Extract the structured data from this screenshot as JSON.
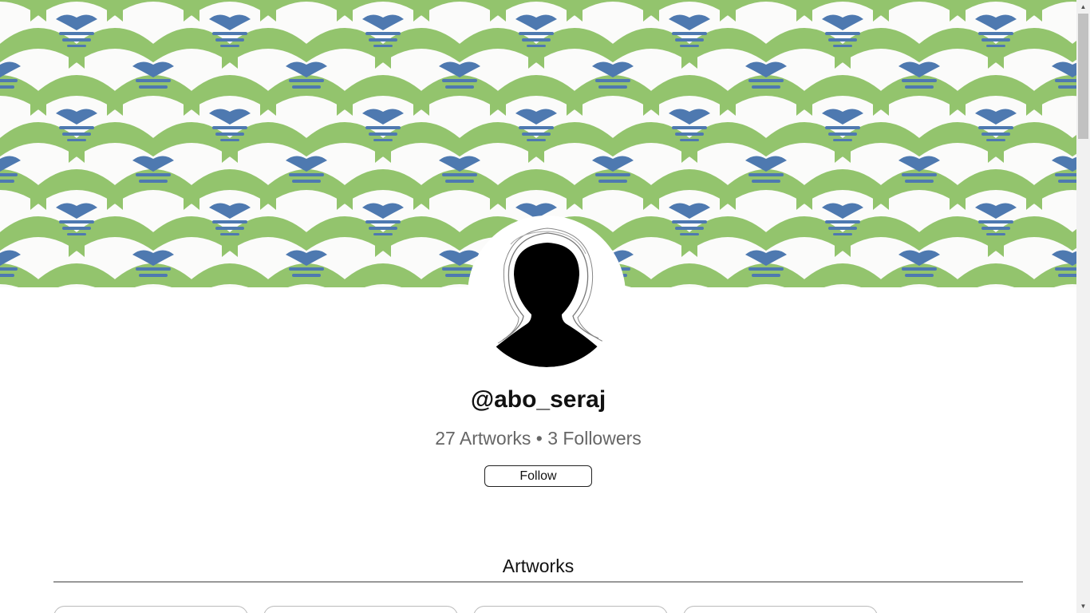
{
  "profile": {
    "username": "@abo_seraj",
    "stats": "27 Artworks • 3 Followers",
    "follow_label": "Follow"
  },
  "artworks": {
    "title": "Artworks",
    "card_count_visible": 4
  },
  "colors": {
    "banner_green": "#93c46d",
    "banner_blue": "#4e79b0",
    "banner_white": "#fbfbfa",
    "avatar_fill": "#000000"
  },
  "icons": {
    "avatar": "default-user-silhouette-icon",
    "scroll_up": "scroll-up-arrow-icon",
    "scroll_down": "scroll-down-arrow-icon"
  }
}
